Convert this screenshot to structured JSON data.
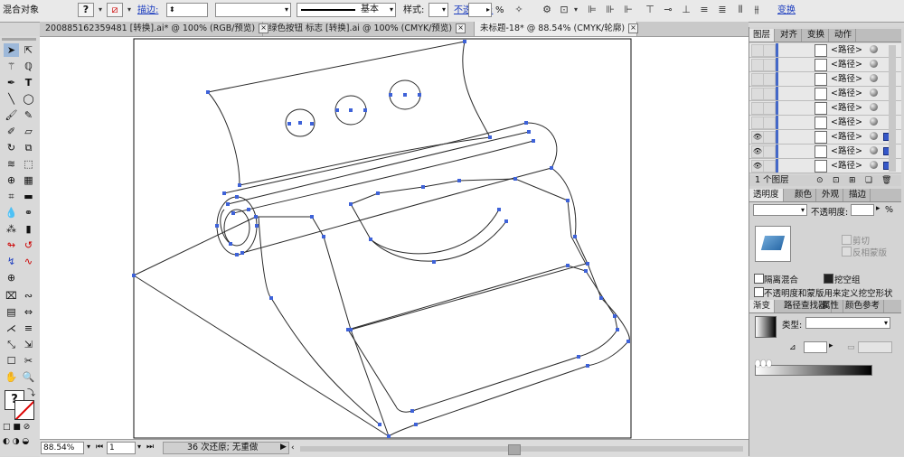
{
  "control_bar": {
    "selection_type": "混合对象",
    "stroke_label": "描边:",
    "stroke_weight_value": "",
    "profile_value": "",
    "brush_value": "基本",
    "style_label": "样式:",
    "opacity_label": "不透明度:",
    "opacity_value": "",
    "opacity_unit": "%",
    "transform_label": "变换",
    "fill_icon": "question-mark",
    "stroke_icon": "no-stroke-slash"
  },
  "document_tabs": [
    {
      "label": "200885162359481 [转换].ai* @ 100% (RGB/预览)",
      "close": "×"
    },
    {
      "label": "绿色按钮 标志 [转换].ai @ 100% (CMYK/预览)",
      "close": "×"
    },
    {
      "label": "未标题-18* @ 88.54% (CMYK/轮廓)",
      "close": "×"
    }
  ],
  "status_bar": {
    "zoom": "88.54%",
    "artboard": "1",
    "history_text": "36 次还原; 无重做"
  },
  "layers_panel": {
    "tabs": [
      "图层",
      "对齐",
      "变换",
      "动作"
    ],
    "rows": [
      {
        "name": "<路径>",
        "visible": false,
        "selected": false
      },
      {
        "name": "<路径>",
        "visible": false,
        "selected": false
      },
      {
        "name": "<路径>",
        "visible": false,
        "selected": false
      },
      {
        "name": "<路径>",
        "visible": false,
        "selected": false
      },
      {
        "name": "<路径>",
        "visible": false,
        "selected": false
      },
      {
        "name": "<路径>",
        "visible": false,
        "selected": false
      },
      {
        "name": "<路径>",
        "visible": true,
        "selected": true
      },
      {
        "name": "<路径>",
        "visible": true,
        "selected": true
      },
      {
        "name": "<路径>",
        "visible": true,
        "selected": true
      }
    ],
    "footer_text": "1 个图层"
  },
  "transparency_panel": {
    "tabs": [
      "透明度",
      "颜色",
      "外观",
      "描边"
    ],
    "blend_mode_value": "",
    "opacity_label": "不透明度:",
    "opacity_value": "",
    "clip_label": "剪切",
    "invert_mask_label": "反相蒙版",
    "isolate_label": "隔离混合",
    "knockout_label": "挖空组",
    "opacity_mask_label": "不透明度和蒙版用来定义挖空形状"
  },
  "gradient_panel": {
    "tabs": [
      "渐变",
      "路径查找器",
      "属性",
      "颜色参考"
    ],
    "type_label": "类型:",
    "type_value": ""
  },
  "colors": {
    "anchor": "#3e62d8",
    "selection": "#3557c8",
    "canvas": "#ffffff"
  }
}
